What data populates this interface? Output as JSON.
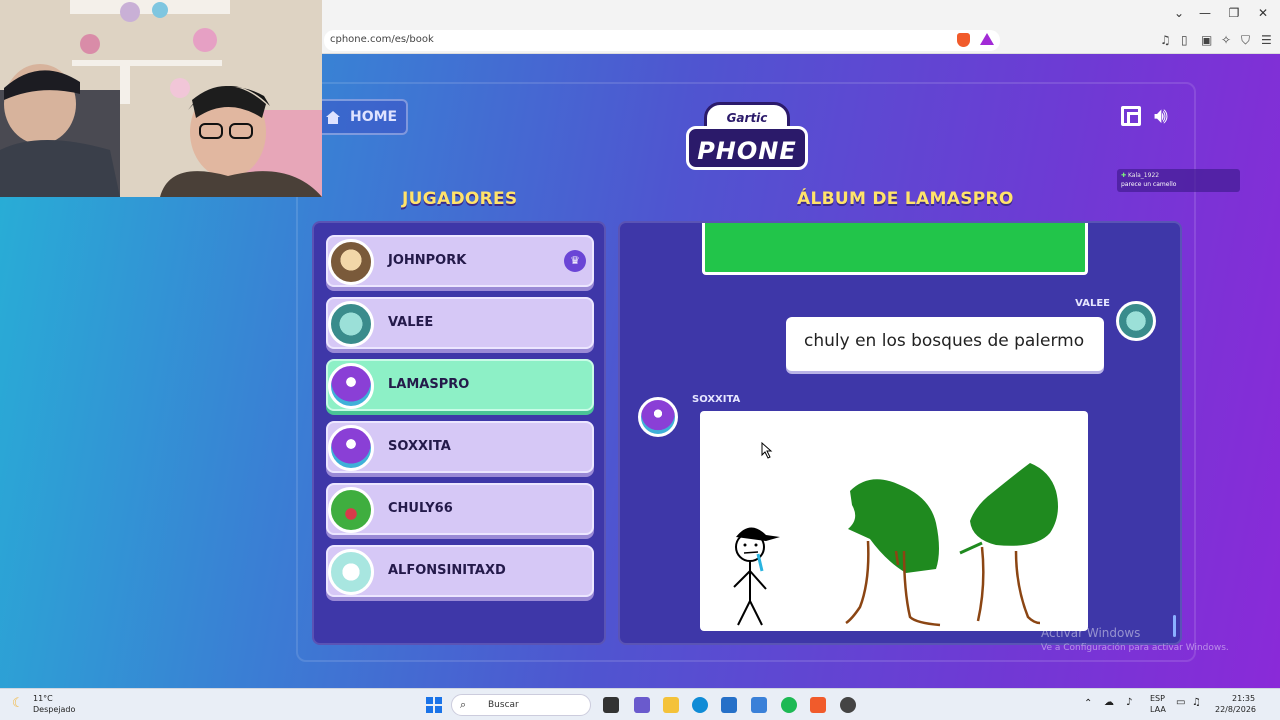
{
  "browser": {
    "url": "cphone.com/es/book",
    "window_controls": [
      "⌄",
      "—",
      "❐",
      "✕"
    ]
  },
  "game": {
    "home_label": "HOME",
    "logo_top": "Gartic",
    "logo_bottom": "PHONE",
    "players_heading": "JUGADORES",
    "album_heading": "ÁLBUM DE LAMASPRO",
    "players": [
      {
        "name": "JOHNPORK",
        "host": true,
        "active": false,
        "avatar": "dog-avatar"
      },
      {
        "name": "VALEE",
        "host": false,
        "active": false,
        "avatar": "teal-monster-avatar"
      },
      {
        "name": "LAMASPRO",
        "host": false,
        "active": true,
        "avatar": "purple-bird-avatar"
      },
      {
        "name": "SOXXITA",
        "host": false,
        "active": false,
        "avatar": "purple-bird-avatar"
      },
      {
        "name": "CHULY66",
        "host": false,
        "active": false,
        "avatar": "green-frog-avatar"
      },
      {
        "name": "ALFONSINITAXD",
        "host": false,
        "active": false,
        "avatar": "ghost-avatar"
      }
    ],
    "album": {
      "entry1_author": "VALEE",
      "entry1_text": "chuly en los bosques de palermo",
      "entry2_author": "SOXXITA"
    }
  },
  "chat_overlay": {
    "user": "Kala_1922",
    "message": "parece un camello"
  },
  "watermark": {
    "line1": "Activar Windows",
    "line2": "Ve a Configuración para activar Windows."
  },
  "taskbar": {
    "weather_temp": "11°C",
    "weather_desc": "Despejado",
    "search_placeholder": "Buscar",
    "lang1": "ESP",
    "lang2": "LAA",
    "time": "21:35",
    "date": "22/8/2026"
  },
  "colors": {
    "heading": "#ffe36a",
    "active_player": "#8df0c6",
    "player": "#d6c8f6",
    "panel": "#3e37a8"
  }
}
